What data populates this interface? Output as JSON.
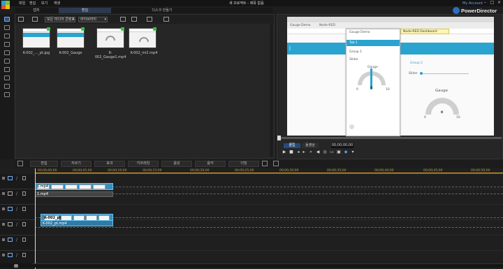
{
  "app": {
    "brand": "PowerDirector",
    "project_title": "새 프로젝트 - 제목 없음",
    "account_label": "My Account"
  },
  "menu": [
    "파일",
    "편집",
    "보기",
    "재생"
  ],
  "room_tabs": [
    {
      "label": "캡처",
      "active": false
    },
    {
      "label": "편집",
      "active": true
    },
    {
      "label": "디스크 만들기",
      "active": false
    }
  ],
  "library": {
    "dropdown_media": "모든 미디어 콘텐츠",
    "dropdown_sort": "라이브러리",
    "items": [
      {
        "label": "K-002_..._pt.jpg"
      },
      {
        "label": "K-002_Gauge"
      },
      {
        "label": "K-002_Gauge1.mp4"
      },
      {
        "label": "K-002_mi2.mp4"
      }
    ]
  },
  "preview": {
    "browser_tab1": "Gauge Demo",
    "browser_tab2": "Node-RED",
    "address": "Node-RED Dashboard",
    "nav_items": [
      "Tab 1",
      "Group 1",
      "Group 2"
    ],
    "slider_label": "Slider",
    "gauge_title": "Gauge",
    "gauge_min": "0",
    "gauge_max": "10",
    "gauge_value": "0",
    "group_label": "Group 2",
    "big_gauge_title": "Gauge",
    "big_gauge_min": "0",
    "big_gauge_max": "10",
    "big_gauge_value": "0"
  },
  "playback": {
    "clip_mode": "클립",
    "movie_mode": "동영상",
    "timecode": "00;00;00;00"
  },
  "timeline_toolbar": [
    "편집",
    "자르기",
    "효과",
    "키프레임",
    "음성",
    "음악",
    "더빙"
  ],
  "ruler_ticks": [
    "00;00;00;00",
    "00;00;05;00",
    "00;00;10;00",
    "00;00;15;00",
    "00;00;20;00",
    "00;00;25;00",
    "00;00;30;00",
    "00;00;35;00",
    "00;00;40;00",
    "00;00;45;00",
    "00;00;50;00"
  ],
  "tracks": {
    "clip1_label": "1.mp4",
    "clip1_audio_label": "1.mp4",
    "clip2_label": "K-002_pt",
    "clip2_audio_label": "K-002_pt.mp4"
  },
  "colors": {
    "accent": "#2aa3cf",
    "timeline_clip": "#3a8fc0",
    "ruler": "#d9a126"
  }
}
